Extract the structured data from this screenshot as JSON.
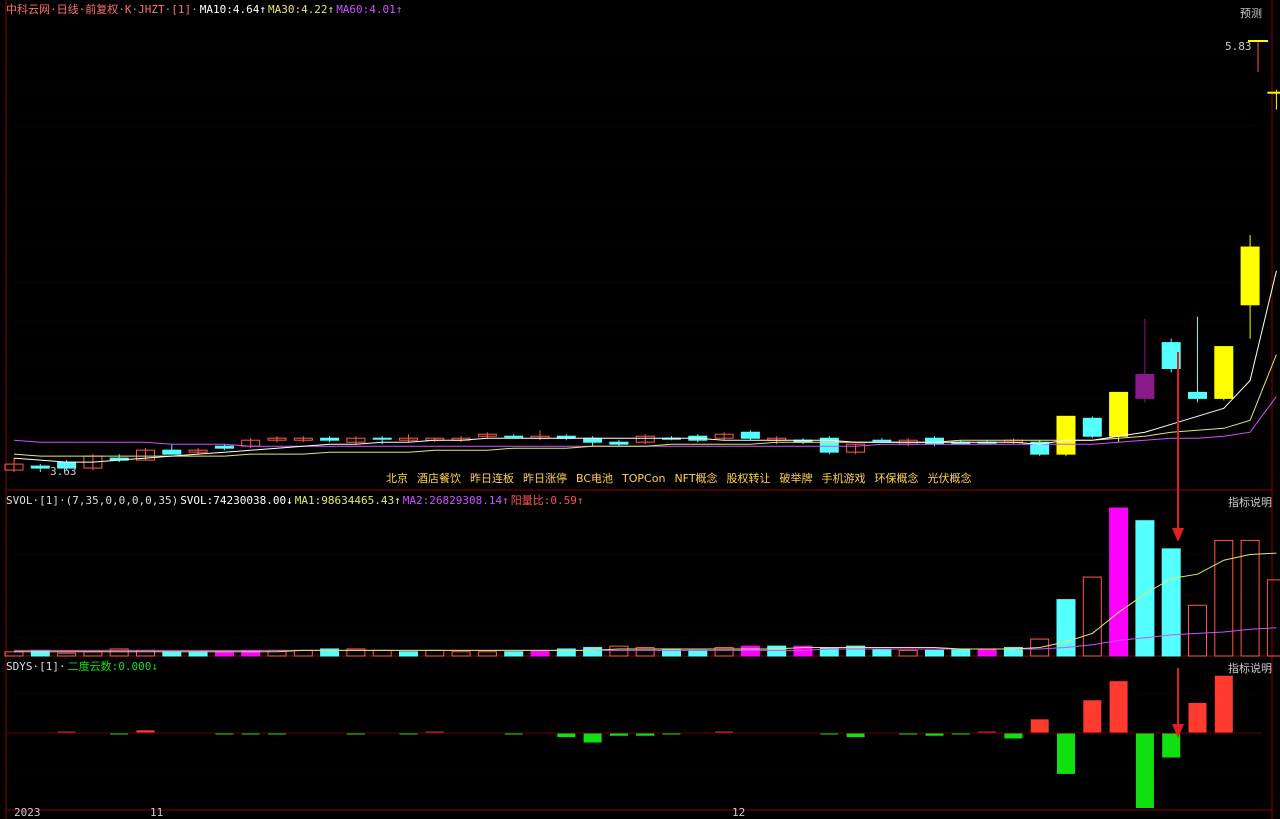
{
  "colors": {
    "up": "#ff5a46",
    "down": "#54ffff",
    "limit_up": "#ffff00",
    "pink": "#ff00ff",
    "purple": "#8a1a8a",
    "ma10": "#ffffff",
    "ma30": "#e6e66a",
    "ma60": "#d050ff",
    "panel_line": "#8b0000",
    "sdys_pos": "#ff3b30",
    "sdys_neg": "#10e010",
    "concept_text": "#ffd24a",
    "arrow": "#e02020"
  },
  "main_panel": {
    "title": "中科云网·日线·前复权·K·JHZT·[1]·",
    "ma10_label": "MA10:4.64↑",
    "ma30_label": "MA30:4.22↑",
    "ma60_label": "MA60:4.01↑",
    "predict_button": "预测",
    "high_label": "5.83",
    "low_label": "3.63",
    "concepts": [
      "北京",
      "酒店餐饮",
      "昨日连板",
      "昨日涨停",
      "BC电池",
      "TOPCon",
      "NFT概念",
      "股权转让",
      "破举牌",
      "手机游戏",
      "环保概念",
      "光伏概念"
    ]
  },
  "vol_panel": {
    "title": "SVOL·[1]·(7,35,0,0,0,0,35)",
    "svol_label": "SVOL:74230038.00↓",
    "ma1_label": "MA1:98634465.43↑",
    "ma2_label": "MA2:26829308.14↑",
    "ratio_label": "阳量比:0.59↑",
    "help_button": "指标说明"
  },
  "sdys_panel": {
    "title": "SDYS·[1]·",
    "value_label": "二度云数:0.000↓",
    "help_button": "指标说明"
  },
  "x_axis": {
    "labels": [
      "2023",
      "11",
      "12"
    ]
  },
  "chart_data": [
    {
      "type": "candlestick",
      "name": "K",
      "ylim": [
        3.55,
        5.9
      ],
      "candles": [
        {
          "o": 3.67,
          "h": 3.7,
          "l": 3.63,
          "c": 3.64,
          "k": "up"
        },
        {
          "o": 3.66,
          "h": 3.67,
          "l": 3.63,
          "c": 3.65,
          "k": "down"
        },
        {
          "o": 3.68,
          "h": 3.69,
          "l": 3.64,
          "c": 3.65,
          "k": "down"
        },
        {
          "o": 3.65,
          "h": 3.72,
          "l": 3.64,
          "c": 3.71,
          "k": "up"
        },
        {
          "o": 3.69,
          "h": 3.72,
          "l": 3.68,
          "c": 3.7,
          "k": "flat"
        },
        {
          "o": 3.69,
          "h": 3.75,
          "l": 3.69,
          "c": 3.74,
          "k": "up"
        },
        {
          "o": 3.74,
          "h": 3.77,
          "l": 3.72,
          "c": 3.72,
          "k": "down"
        },
        {
          "o": 3.73,
          "h": 3.75,
          "l": 3.72,
          "c": 3.74,
          "k": "up"
        },
        {
          "o": 3.76,
          "h": 3.77,
          "l": 3.74,
          "c": 3.75,
          "k": "down"
        },
        {
          "o": 3.76,
          "h": 3.8,
          "l": 3.75,
          "c": 3.79,
          "k": "up"
        },
        {
          "o": 3.79,
          "h": 3.81,
          "l": 3.78,
          "c": 3.8,
          "k": "up"
        },
        {
          "o": 3.79,
          "h": 3.81,
          "l": 3.78,
          "c": 3.8,
          "k": "up"
        },
        {
          "o": 3.8,
          "h": 3.81,
          "l": 3.78,
          "c": 3.79,
          "k": "down"
        },
        {
          "o": 3.78,
          "h": 3.81,
          "l": 3.77,
          "c": 3.8,
          "k": "up"
        },
        {
          "o": 3.8,
          "h": 3.81,
          "l": 3.77,
          "c": 3.8,
          "k": "flat"
        },
        {
          "o": 3.79,
          "h": 3.82,
          "l": 3.78,
          "c": 3.8,
          "k": "up"
        },
        {
          "o": 3.79,
          "h": 3.8,
          "l": 3.78,
          "c": 3.8,
          "k": "up"
        },
        {
          "o": 3.79,
          "h": 3.81,
          "l": 3.78,
          "c": 3.8,
          "k": "up"
        },
        {
          "o": 3.81,
          "h": 3.83,
          "l": 3.8,
          "c": 3.82,
          "k": "up"
        },
        {
          "o": 3.81,
          "h": 3.82,
          "l": 3.8,
          "c": 3.81,
          "k": "flat"
        },
        {
          "o": 3.8,
          "h": 3.84,
          "l": 3.79,
          "c": 3.81,
          "k": "up"
        },
        {
          "o": 3.81,
          "h": 3.82,
          "l": 3.79,
          "c": 3.8,
          "k": "down"
        },
        {
          "o": 3.8,
          "h": 3.81,
          "l": 3.76,
          "c": 3.78,
          "k": "down"
        },
        {
          "o": 3.78,
          "h": 3.79,
          "l": 3.76,
          "c": 3.77,
          "k": "down"
        },
        {
          "o": 3.78,
          "h": 3.82,
          "l": 3.77,
          "c": 3.81,
          "k": "up"
        },
        {
          "o": 3.8,
          "h": 3.81,
          "l": 3.79,
          "c": 3.8,
          "k": "flat"
        },
        {
          "o": 3.81,
          "h": 3.82,
          "l": 3.78,
          "c": 3.79,
          "k": "down"
        },
        {
          "o": 3.8,
          "h": 3.83,
          "l": 3.79,
          "c": 3.82,
          "k": "up"
        },
        {
          "o": 3.83,
          "h": 3.84,
          "l": 3.79,
          "c": 3.8,
          "k": "down"
        },
        {
          "o": 3.79,
          "h": 3.81,
          "l": 3.77,
          "c": 3.8,
          "k": "up"
        },
        {
          "o": 3.78,
          "h": 3.8,
          "l": 3.77,
          "c": 3.79,
          "k": "flat"
        },
        {
          "o": 3.8,
          "h": 3.81,
          "l": 3.72,
          "c": 3.73,
          "k": "down"
        },
        {
          "o": 3.73,
          "h": 3.77,
          "l": 3.72,
          "c": 3.77,
          "k": "up"
        },
        {
          "o": 3.79,
          "h": 3.8,
          "l": 3.78,
          "c": 3.79,
          "k": "flat"
        },
        {
          "o": 3.77,
          "h": 3.8,
          "l": 3.76,
          "c": 3.79,
          "k": "up"
        },
        {
          "o": 3.8,
          "h": 3.81,
          "l": 3.76,
          "c": 3.77,
          "k": "down"
        },
        {
          "o": 3.78,
          "h": 3.79,
          "l": 3.77,
          "c": 3.77,
          "k": "down"
        },
        {
          "o": 3.78,
          "h": 3.79,
          "l": 3.77,
          "c": 3.78,
          "k": "flat"
        },
        {
          "o": 3.79,
          "h": 3.8,
          "l": 3.77,
          "c": 3.78,
          "k": "up"
        },
        {
          "o": 3.78,
          "h": 3.79,
          "l": 3.71,
          "c": 3.72,
          "k": "down"
        },
        {
          "o": 3.72,
          "h": 3.91,
          "l": 3.71,
          "c": 3.91,
          "k": "limit_up"
        },
        {
          "o": 3.9,
          "h": 3.91,
          "l": 3.8,
          "c": 3.81,
          "k": "down"
        },
        {
          "o": 3.81,
          "h": 4.03,
          "l": 3.78,
          "c": 4.03,
          "k": "limit_up"
        },
        {
          "o": 4.12,
          "h": 4.4,
          "l": 3.98,
          "c": 4.0,
          "k": "purple"
        },
        {
          "o": 4.28,
          "h": 4.3,
          "l": 4.13,
          "c": 4.15,
          "k": "down"
        },
        {
          "o": 4.03,
          "h": 4.41,
          "l": 3.98,
          "c": 4.0,
          "k": "down"
        },
        {
          "o": 4.0,
          "h": 4.26,
          "l": 3.99,
          "c": 4.26,
          "k": "limit_up"
        },
        {
          "o": 4.47,
          "h": 4.82,
          "l": 4.3,
          "c": 4.76,
          "k": "limit_up"
        },
        {
          "o": 5.54,
          "h": 5.55,
          "l": 5.45,
          "c": 5.54,
          "k": "limit_up_dash"
        }
      ],
      "ma10": [
        3.7,
        3.69,
        3.68,
        3.68,
        3.69,
        3.7,
        3.71,
        3.72,
        3.73,
        3.74,
        3.75,
        3.76,
        3.77,
        3.77,
        3.78,
        3.78,
        3.79,
        3.79,
        3.8,
        3.8,
        3.8,
        3.8,
        3.8,
        3.8,
        3.8,
        3.8,
        3.8,
        3.79,
        3.79,
        3.79,
        3.79,
        3.79,
        3.78,
        3.78,
        3.78,
        3.78,
        3.78,
        3.78,
        3.78,
        3.77,
        3.79,
        3.79,
        3.81,
        3.83,
        3.87,
        3.91,
        3.95,
        4.09,
        4.64
      ],
      "ma30": [
        3.72,
        3.71,
        3.71,
        3.71,
        3.71,
        3.71,
        3.71,
        3.71,
        3.71,
        3.72,
        3.72,
        3.72,
        3.73,
        3.73,
        3.73,
        3.73,
        3.74,
        3.74,
        3.74,
        3.75,
        3.75,
        3.75,
        3.76,
        3.76,
        3.76,
        3.77,
        3.77,
        3.77,
        3.77,
        3.78,
        3.78,
        3.78,
        3.78,
        3.78,
        3.78,
        3.78,
        3.79,
        3.79,
        3.79,
        3.79,
        3.79,
        3.79,
        3.8,
        3.81,
        3.83,
        3.84,
        3.85,
        3.89,
        4.22
      ],
      "ma60": [
        3.79,
        3.78,
        3.78,
        3.78,
        3.78,
        3.78,
        3.77,
        3.77,
        3.77,
        3.76,
        3.76,
        3.76,
        3.76,
        3.76,
        3.76,
        3.76,
        3.76,
        3.76,
        3.76,
        3.76,
        3.76,
        3.76,
        3.76,
        3.76,
        3.76,
        3.76,
        3.76,
        3.76,
        3.76,
        3.76,
        3.76,
        3.76,
        3.76,
        3.77,
        3.77,
        3.77,
        3.77,
        3.77,
        3.77,
        3.77,
        3.77,
        3.77,
        3.78,
        3.79,
        3.8,
        3.8,
        3.81,
        3.83,
        4.01
      ]
    },
    {
      "type": "bar",
      "name": "SVOL",
      "ylim": [
        0,
        105
      ],
      "values": [
        3,
        4,
        2,
        3,
        5,
        4,
        3,
        3,
        3,
        4,
        4,
        4,
        5,
        5,
        4,
        3,
        4,
        3,
        3,
        3,
        4,
        5,
        6,
        7,
        6,
        5,
        4,
        6,
        7,
        7,
        7,
        6,
        7,
        5,
        4,
        4,
        5,
        5,
        6,
        12,
        40,
        56,
        105,
        96,
        76,
        36,
        82,
        82,
        54
      ],
      "kinds": [
        "up",
        "down",
        "up",
        "up",
        "up",
        "up",
        "down",
        "down",
        "pink",
        "pink",
        "up",
        "up",
        "down",
        "up",
        "up",
        "down",
        "up",
        "up",
        "up",
        "down",
        "pink",
        "down",
        "down",
        "up",
        "up",
        "down",
        "down",
        "up",
        "pink",
        "down",
        "pink",
        "down",
        "down",
        "down",
        "up",
        "down",
        "down",
        "pink",
        "down",
        "up",
        "down",
        "up",
        "pink",
        "down",
        "down",
        "up",
        "up",
        "up",
        "up"
      ],
      "ma1": [
        3,
        3,
        3,
        3,
        3,
        3,
        3,
        3,
        3,
        3,
        3,
        4,
        4,
        4,
        4,
        4,
        4,
        4,
        4,
        4,
        4,
        4,
        4,
        5,
        5,
        5,
        5,
        5,
        5,
        5,
        6,
        6,
        6,
        6,
        6,
        6,
        5,
        5,
        5,
        6,
        10,
        16,
        31,
        44,
        55,
        58,
        68,
        72,
        73
      ],
      "ma2": [
        4,
        4,
        4,
        4,
        4,
        4,
        4,
        4,
        4,
        4,
        4,
        4,
        4,
        4,
        4,
        4,
        4,
        4,
        4,
        4,
        4,
        4,
        4,
        4,
        4,
        4,
        4,
        4,
        4,
        4,
        4,
        5,
        5,
        5,
        5,
        5,
        5,
        5,
        5,
        5,
        6,
        8,
        11,
        13,
        15,
        16,
        17,
        19,
        20
      ]
    },
    {
      "type": "bar",
      "name": "SDYS",
      "ylim": [
        -55,
        45
      ],
      "values": [
        0,
        0,
        1,
        0,
        -1,
        2,
        0,
        0,
        -0.5,
        -1,
        -1,
        0,
        0,
        -0.5,
        0,
        -1,
        1,
        0,
        0,
        -1,
        0,
        -3,
        -7,
        -2,
        -2,
        -1,
        0,
        1,
        0,
        0,
        0,
        -1,
        -3,
        0,
        -0.5,
        -2,
        -0.5,
        1,
        -4,
        10,
        -30,
        24,
        38,
        -55,
        -18,
        22,
        42,
        0,
        0
      ]
    }
  ]
}
